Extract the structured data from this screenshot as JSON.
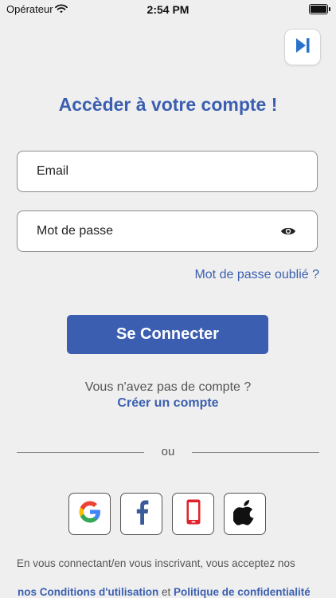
{
  "status_bar": {
    "carrier": "Opérateur",
    "time": "2:54 PM"
  },
  "login": {
    "title": "Accèder à votre compte !",
    "email_placeholder": "Email",
    "password_placeholder": "Mot de passe",
    "forgot_password": "Mot de passe oublié ?",
    "connect_button": "Se Connecter",
    "no_account": "Vous n'avez pas de compte ?",
    "create_account": "Créer un compte",
    "divider": "ou"
  },
  "social": [
    {
      "icon": "google-icon"
    },
    {
      "icon": "facebook-icon"
    },
    {
      "icon": "phone-icon"
    },
    {
      "icon": "apple-icon"
    }
  ],
  "legal": {
    "text": "En vous connectant/en vous inscrivant, vous acceptez nos",
    "terms": "nos Conditions d'utilisation",
    "and": "et",
    "privacy": "Politique de confidentialité"
  },
  "colors": {
    "accent": "#3b5fb0",
    "button": "#3b5eb1",
    "background": "#efefef"
  }
}
